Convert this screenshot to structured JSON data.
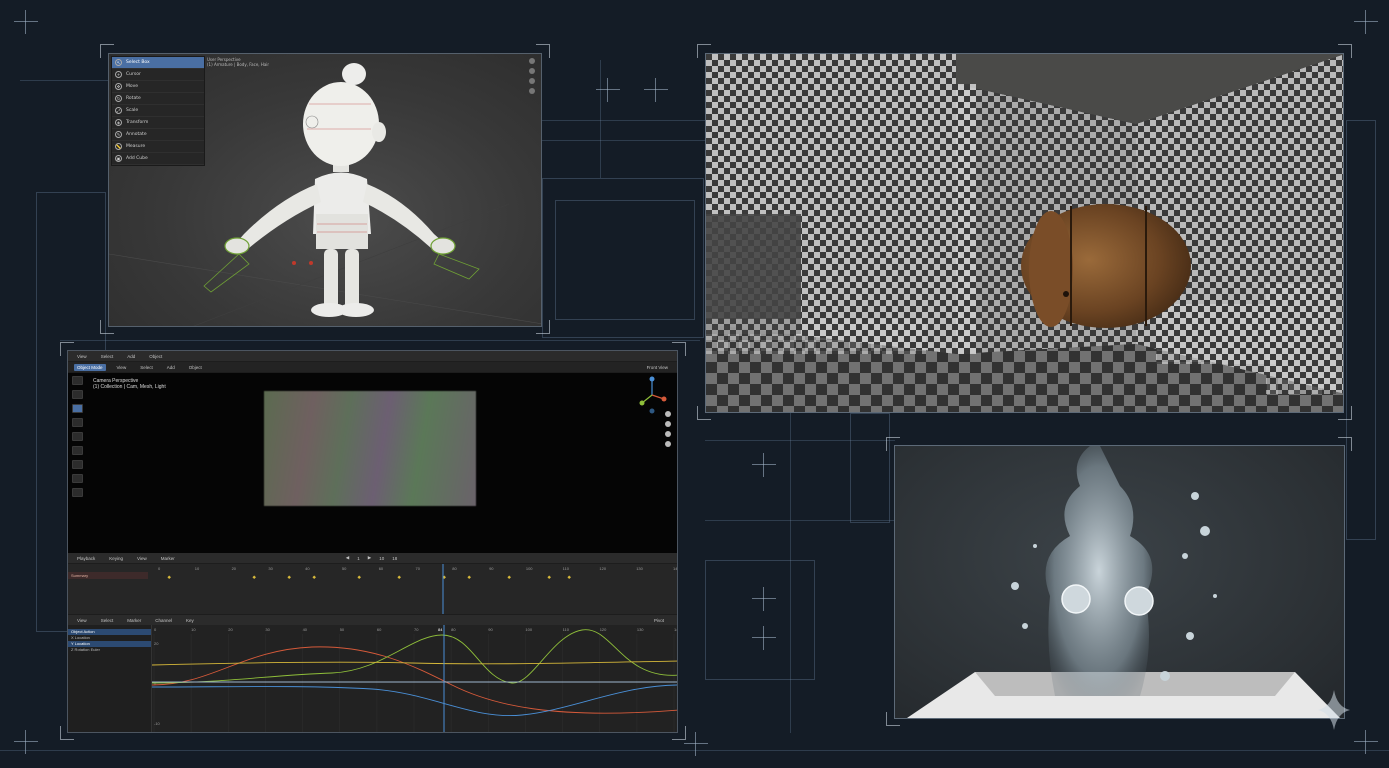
{
  "character_viewport": {
    "menu_items": [
      {
        "label": "Select Box",
        "icon": "cursor-icon",
        "active": true
      },
      {
        "label": "Cursor",
        "icon": "crosshair-icon",
        "active": false
      },
      {
        "label": "Move",
        "icon": "move-icon",
        "active": false
      },
      {
        "label": "Rotate",
        "icon": "rotate-icon",
        "active": false
      },
      {
        "label": "Scale",
        "icon": "scale-icon",
        "active": false
      },
      {
        "label": "Transform",
        "icon": "transform-icon",
        "active": false
      },
      {
        "label": "Annotate",
        "icon": "annotate-icon",
        "active": false
      },
      {
        "label": "Measure",
        "icon": "measure-icon",
        "active": false
      },
      {
        "label": "Add Cube",
        "icon": "cube-icon",
        "active": false
      }
    ],
    "header_text": [
      "User Perspective",
      "(1) Armature | Body, Face, Hair"
    ]
  },
  "editor": {
    "topbar": [
      "View",
      "Select",
      "Add",
      "Object"
    ],
    "viewport_header": [
      "Object Mode",
      "View",
      "Select",
      "Add",
      "Object"
    ],
    "overlay_lines": [
      "Camera Perspective",
      "(1) Collection | Cam, Mesh, Light"
    ],
    "view_label": "Front View",
    "playback": [
      "Playback",
      "Keying",
      "View",
      "Marker"
    ],
    "frame_controls": [
      "1",
      "10",
      "18"
    ],
    "dopesheet_channel": "Summary",
    "graph_header": [
      "View",
      "Select",
      "Marker",
      "Channel",
      "Key"
    ],
    "graph_channels": [
      {
        "label": "Object Action",
        "active": true
      },
      {
        "label": "X Location",
        "active": false
      },
      {
        "label": "Y Location",
        "active": true
      },
      {
        "label": "Z Rotation Euler",
        "active": false
      }
    ],
    "ruler": [
      "0",
      "10",
      "20",
      "30",
      "40",
      "50",
      "60",
      "70",
      "80",
      "90",
      "100",
      "110",
      "120",
      "130",
      "140"
    ],
    "current_frame": "84",
    "yaxis": [
      "20",
      "0",
      "-10"
    ],
    "pivot_label": "Pivot"
  },
  "colors": {
    "accent": "#4a6fa3",
    "curve_red": "#d65a3a",
    "curve_green": "#8fbf3a",
    "curve_blue": "#4a8fd6",
    "curve_yellow": "#d6b83a",
    "blueprint_line": "#6e87a5"
  }
}
